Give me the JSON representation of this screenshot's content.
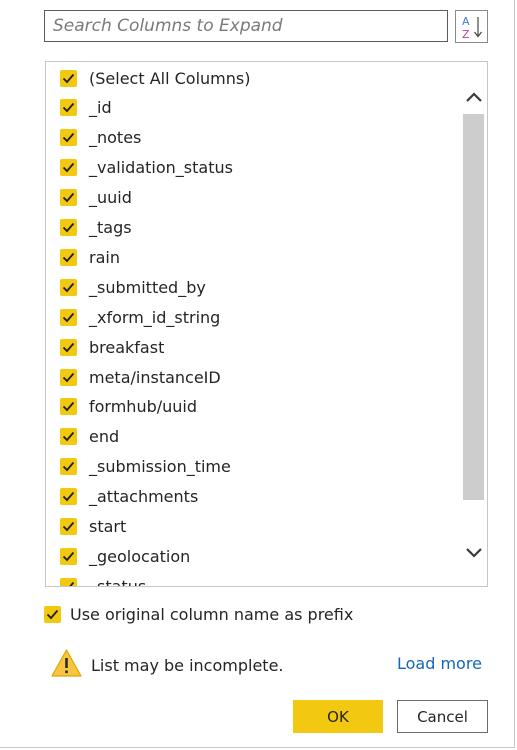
{
  "search": {
    "placeholder": "Search Columns to Expand",
    "value": ""
  },
  "sort_button": {
    "icon": "sort-az-icon",
    "glyph_top": "A",
    "glyph_bottom": "Z"
  },
  "columns": {
    "items": [
      {
        "label": "(Select All Columns)",
        "checked": true
      },
      {
        "label": "_id",
        "checked": true
      },
      {
        "label": "_notes",
        "checked": true
      },
      {
        "label": "_validation_status",
        "checked": true
      },
      {
        "label": "_uuid",
        "checked": true
      },
      {
        "label": "_tags",
        "checked": true
      },
      {
        "label": "rain",
        "checked": true
      },
      {
        "label": "_submitted_by",
        "checked": true
      },
      {
        "label": "_xform_id_string",
        "checked": true
      },
      {
        "label": "breakfast",
        "checked": true
      },
      {
        "label": "meta/instanceID",
        "checked": true
      },
      {
        "label": "formhub/uuid",
        "checked": true
      },
      {
        "label": "end",
        "checked": true
      },
      {
        "label": "_submission_time",
        "checked": true
      },
      {
        "label": "_attachments",
        "checked": true
      },
      {
        "label": "start",
        "checked": true
      },
      {
        "label": "_geolocation",
        "checked": true
      },
      {
        "label": "_status",
        "checked": true
      }
    ]
  },
  "prefix_option": {
    "label": "Use original column name as prefix",
    "checked": true
  },
  "warning": {
    "icon": "warning-icon",
    "text": "List may be incomplete."
  },
  "load_more": {
    "label": "Load more"
  },
  "buttons": {
    "ok_label": "OK",
    "cancel_label": "Cancel"
  },
  "colors": {
    "accent": "#f2c811",
    "link": "#1466b8",
    "warning": "#f0b400"
  }
}
